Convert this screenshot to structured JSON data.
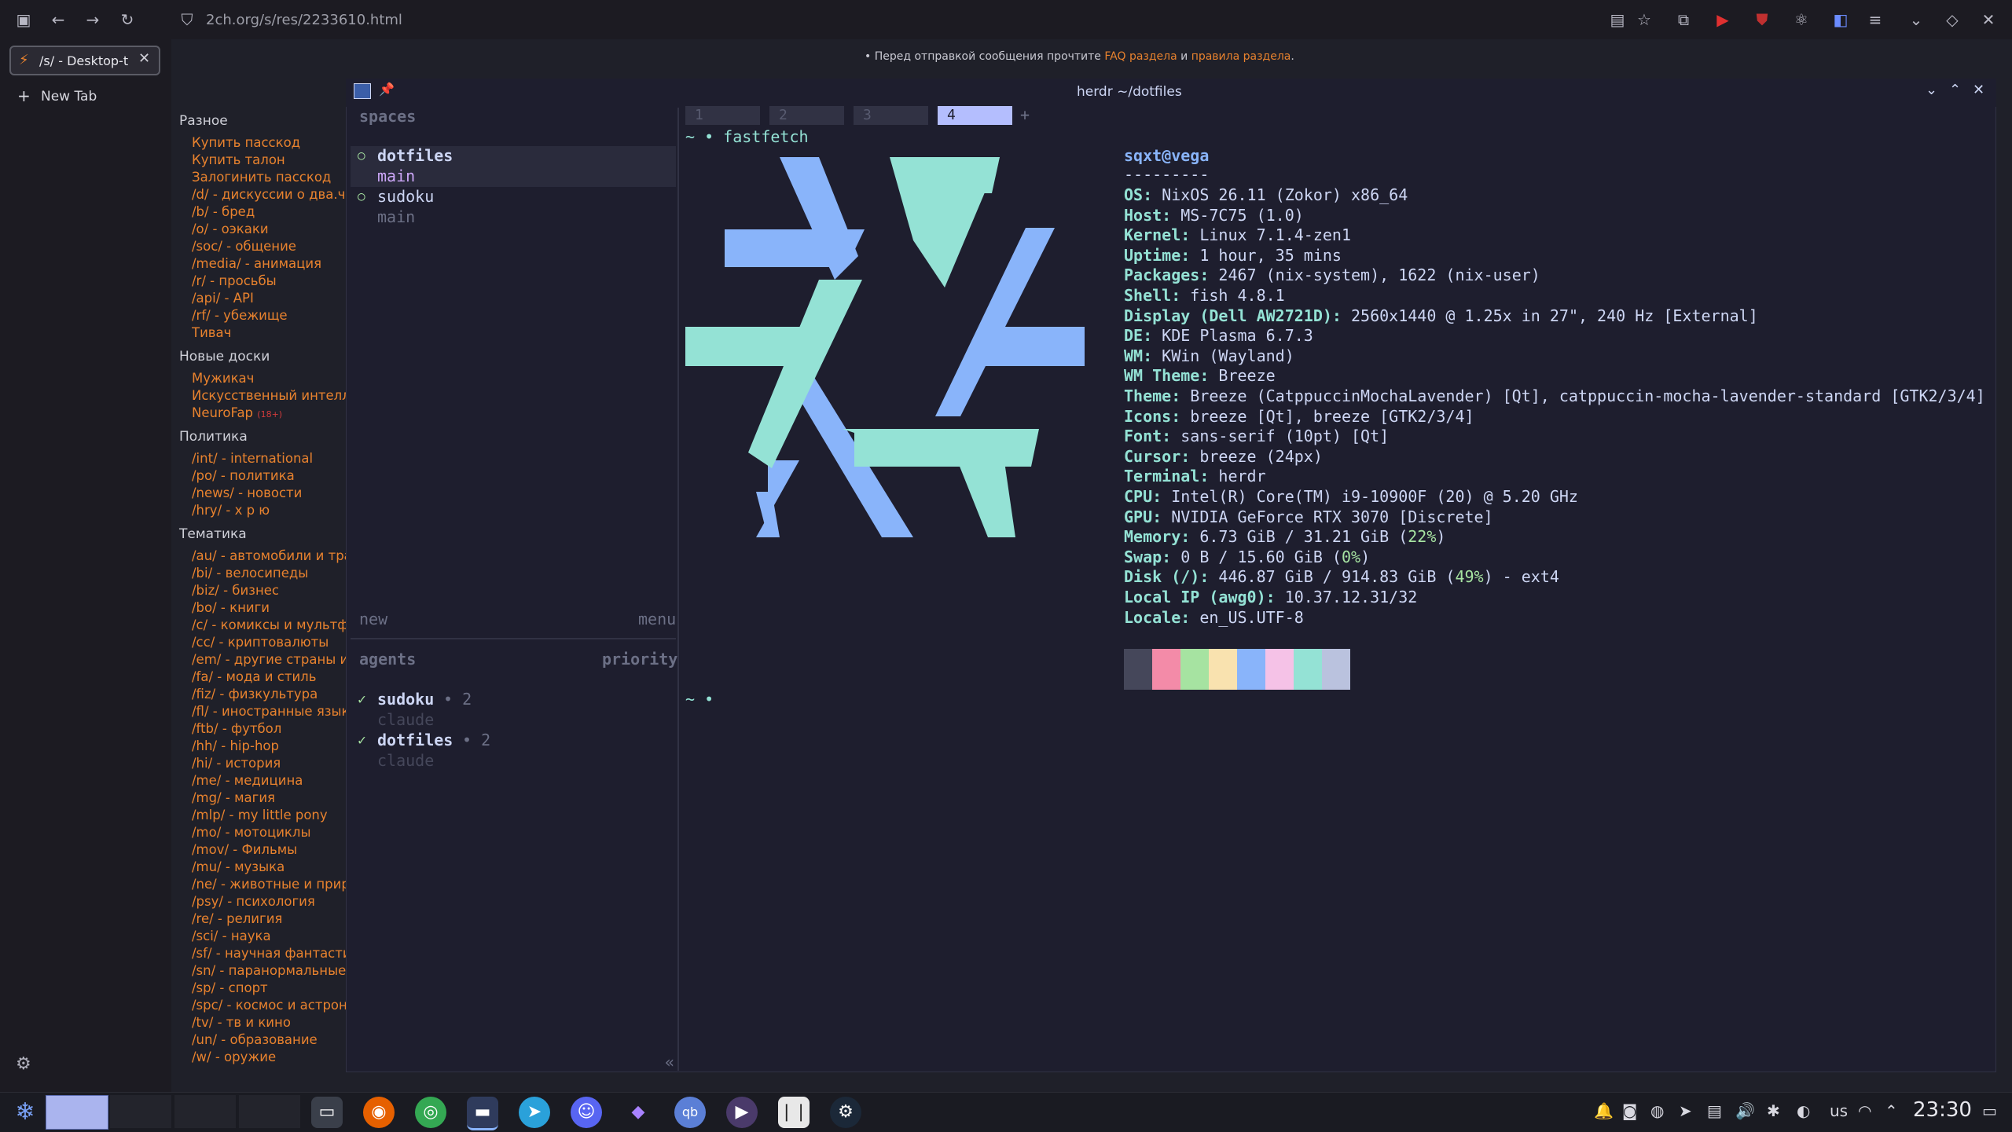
{
  "browser": {
    "url": "2ch.org/s/res/2233610.html",
    "tab_title": "/s/ - Desktop-t",
    "new_tab": "New Tab"
  },
  "notice": {
    "prefix": "• Перед отправкой сообщения прочтите ",
    "faq": "FAQ раздела",
    "and": " и ",
    "rules": "правила раздела",
    "suffix": "."
  },
  "boards": {
    "misc_title": "Разное",
    "misc": [
      "Купить пасскод",
      "Купить талон",
      "Залогинить пасскод",
      "/d/ - дискуссии о два.ч",
      "/b/ - бред",
      "/o/ - оэкаки",
      "/soc/ - общение",
      "/media/ - анимация",
      "/r/ - просьбы",
      "/api/ - API",
      "/rf/ - убежище",
      "Тивач"
    ],
    "new_title": "Новые доски",
    "new": [
      "Мужикач",
      "Искусственный интеллект",
      "NeuroFap"
    ],
    "tag18": "(18+)",
    "politics_title": "Политика",
    "politics": [
      "/int/ - international",
      "/po/ - политика",
      "/news/ - новости",
      "/hry/ - х р ю"
    ],
    "themes_title": "Тематика",
    "themes": [
      "/au/ - автомобили и транспорт",
      "/bi/ - велосипеды",
      "/biz/ - бизнес",
      "/bo/ - книги",
      "/c/ - комиксы и мультфильмы",
      "/cc/ - криптовалюты",
      "/em/ - другие страны и туризм",
      "/fa/ - мода и стиль",
      "/fiz/ - физкультура",
      "/fl/ - иностранные языки",
      "/ftb/ - футбол",
      "/hh/ - hip-hop",
      "/hi/ - история",
      "/me/ - медицина",
      "/mg/ - магия",
      "/mlp/ - my little pony",
      "/mo/ - мотоциклы",
      "/mov/ - Фильмы",
      "/mu/ - музыка",
      "/ne/ - животные и природа",
      "/psy/ - психология",
      "/re/ - религия",
      "/sci/ - наука",
      "/sf/ - научная фантастика",
      "/sn/ - паранормальные явления",
      "/sp/ - спорт",
      "/spc/ - космос и астрономия",
      "/tv/ - тв и кино",
      "/un/ - образование",
      "/w/ - оружие"
    ]
  },
  "terminal": {
    "title": "herdr ~/dotfiles",
    "tabs": [
      "1",
      "2",
      "3",
      "4"
    ],
    "add_tab": "+",
    "spaces_label": "spaces",
    "spaces": [
      {
        "name": "dotfiles",
        "branch": "main"
      },
      {
        "name": "sudoku",
        "branch": "main"
      }
    ],
    "new_label": "new",
    "menu_label": "menu",
    "agents_label": "agents",
    "priority_label": "priority",
    "agents": [
      {
        "name": "sudoku",
        "count": "• 2",
        "kind": "claude"
      },
      {
        "name": "dotfiles",
        "count": "• 2",
        "kind": "claude"
      }
    ],
    "collapse": "«",
    "prompt_cmd": "~ • fastfetch",
    "prompt_empty": "~ •",
    "check": "✓",
    "circle": "○"
  },
  "fastfetch": {
    "user": "sqxt@vega",
    "sep": "---------",
    "lines": [
      {
        "k": "OS:",
        "v": " NixOS 26.11 (Zokor) x86_64"
      },
      {
        "k": "Host:",
        "v": " MS-7C75 (1.0)"
      },
      {
        "k": "Kernel:",
        "v": " Linux 7.1.4-zen1"
      },
      {
        "k": "Uptime:",
        "v": " 1 hour, 35 mins"
      },
      {
        "k": "Packages:",
        "v": " 2467 (nix-system), 1622 (nix-user)"
      },
      {
        "k": "Shell:",
        "v": " fish 4.8.1"
      },
      {
        "k": "Display (Dell AW2721D):",
        "v": " 2560x1440 @ 1.25x in 27\", 240 Hz [External]"
      },
      {
        "k": "DE:",
        "v": " KDE Plasma 6.7.3"
      },
      {
        "k": "WM:",
        "v": " KWin (Wayland)"
      },
      {
        "k": "WM Theme:",
        "v": " Breeze"
      },
      {
        "k": "Theme:",
        "v": " Breeze (CatppuccinMochaLavender) [Qt], catppuccin-mocha-lavender-standard [GTK2/3/4]"
      },
      {
        "k": "Icons:",
        "v": " breeze [Qt], breeze [GTK2/3/4]"
      },
      {
        "k": "Font:",
        "v": " sans-serif (10pt) [Qt]"
      },
      {
        "k": "Cursor:",
        "v": " breeze (24px)"
      },
      {
        "k": "Terminal:",
        "v": " herdr"
      },
      {
        "k": "CPU:",
        "v": " Intel(R) Core(TM) i9-10900F (20) @ 5.20 GHz"
      },
      {
        "k": "GPU:",
        "v": " NVIDIA GeForce RTX 3070 [Discrete]"
      },
      {
        "k": "Memory:",
        "v": " 6.73 GiB / 31.21 GiB (",
        "p": "22%",
        "e": ")"
      },
      {
        "k": "Swap:",
        "v": " 0 B / 15.60 GiB (",
        "p": "0%",
        "e": ")"
      },
      {
        "k": "Disk (/):",
        "v": " 446.87 GiB / 914.83 GiB (",
        "p": "49%",
        "e": ") - ext4"
      },
      {
        "k": "Local IP (awg0):",
        "v": " 10.37.12.31/32"
      },
      {
        "k": "Locale:",
        "v": " en_US.UTF-8"
      }
    ],
    "palette": [
      "#45475a",
      "#f38ba8",
      "#a6e3a1",
      "#f9e2af",
      "#89b4fa",
      "#f5c2e7",
      "#94e2d5",
      "#bac2de"
    ],
    "logo_colors": {
      "blue": "#89b4fa",
      "teal": "#94e2d5"
    }
  },
  "taskbar": {
    "keyboard_layout": "us",
    "clock": "23:30"
  }
}
